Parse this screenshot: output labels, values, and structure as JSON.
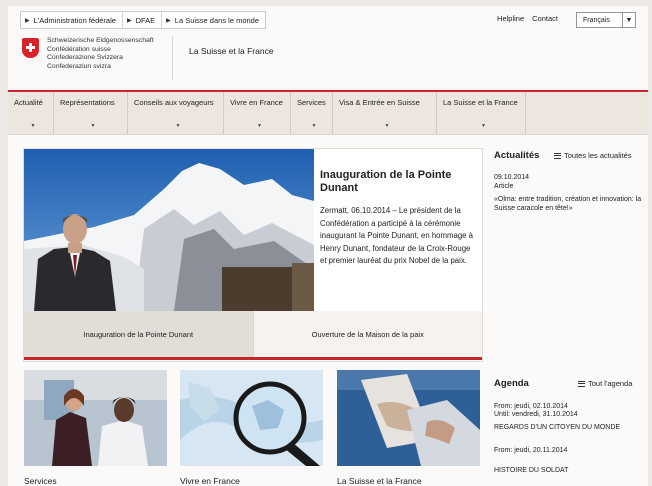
{
  "breadcrumb": [
    "L'Administration fédérale",
    "DFAE",
    "La Suisse dans le monde"
  ],
  "top_links": {
    "helpline": "Helpline",
    "contact": "Contact"
  },
  "language": {
    "selected": "Français"
  },
  "confederation": [
    "Schweizerische Eidgenossenschaft",
    "Confédération suisse",
    "Confederazione Svizzera",
    "Confederaziun svizra"
  ],
  "site_title": "La Suisse et la France",
  "nav": [
    "Actualité",
    "Représentations",
    "Conseils aux voyageurs",
    "Vivre en France",
    "Services",
    "Visa & Entrée en Suisse",
    "La Suisse et la France"
  ],
  "hero": {
    "title": "Inauguration de la Pointe Dunant",
    "text": "Zermatt, 06.10.2014 – Le président de la Confédération a participé à la cérémonie inaugurant la Pointe Dunant, en hommage à Henry Dunant, fondateur de la Croix-Rouge et premier lauréat du prix Nobel de la paix.",
    "tabs": [
      "Inauguration de la Pointe Dunant",
      "Ouverture de la Maison de la paix"
    ]
  },
  "news": {
    "heading": "Actualités",
    "all_link": "Toutes les actualités",
    "date": "09.10.2014",
    "type": "Article",
    "item": "«Olma: entre tradition, création et innovation: la Suisse caracole en tête!»"
  },
  "agenda": {
    "heading": "Agenda",
    "all_link": "Tout l'agenda",
    "event1_from": "From: jeudi, 02.10.2014",
    "event1_until": "Until: vendredi, 31.10.2014",
    "event1_title": "REGARDS D'UN CITOYEN DU MONDE",
    "event2_from": "From: jeudi, 20.11.2014",
    "event2_title": "HISTOIRE DU SOLDAT"
  },
  "tiles": [
    "Services",
    "Vivre en France",
    "La Suisse et la France"
  ],
  "colors": {
    "accent": "#c8262b",
    "nav_bg": "#ece6df"
  }
}
